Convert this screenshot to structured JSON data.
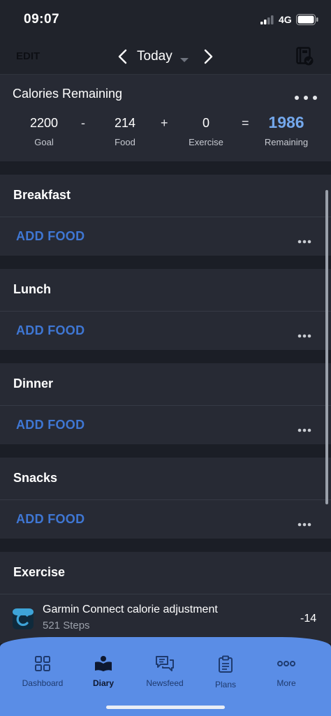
{
  "status_bar": {
    "time": "09:07",
    "network": "4G",
    "icons": [
      "signal-icon",
      "battery-icon"
    ]
  },
  "header": {
    "edit_label": "EDIT",
    "date_label": "Today",
    "icons": [
      "chevron-left-icon",
      "chevron-right-icon",
      "caret-down-icon",
      "calendar-check-icon"
    ]
  },
  "calories": {
    "title": "Calories Remaining",
    "goal": {
      "value": "2200",
      "label": "Goal"
    },
    "minus": "-",
    "food": {
      "value": "214",
      "label": "Food"
    },
    "plus": "+",
    "exercise": {
      "value": "0",
      "label": "Exercise"
    },
    "equals": "=",
    "remaining": {
      "value": "1986",
      "label": "Remaining"
    },
    "accent_color": "#74a8ec"
  },
  "meals": [
    {
      "title": "Breakfast",
      "add_label": "ADD FOOD"
    },
    {
      "title": "Lunch",
      "add_label": "ADD FOOD"
    },
    {
      "title": "Dinner",
      "add_label": "ADD FOOD"
    },
    {
      "title": "Snacks",
      "add_label": "ADD FOOD"
    }
  ],
  "exercise": {
    "title": "Exercise",
    "entry": {
      "name": "Garmin Connect calorie adjustment",
      "detail": "521 Steps",
      "calories": "-14",
      "icon": "garmin-connect-icon"
    }
  },
  "tabs": [
    {
      "label": "Dashboard",
      "icon": "dashboard-grid-icon",
      "active": false
    },
    {
      "label": "Diary",
      "icon": "diary-book-icon",
      "active": true
    },
    {
      "label": "Newsfeed",
      "icon": "newsfeed-chat-icon",
      "active": false
    },
    {
      "label": "Plans",
      "icon": "clipboard-icon",
      "active": false
    },
    {
      "label": "More",
      "icon": "more-dots-icon",
      "active": false
    }
  ],
  "colors": {
    "background": "#1b1e26",
    "card": "#272a34",
    "link": "#3f77d4",
    "tab_bar": "#5a8de6"
  }
}
